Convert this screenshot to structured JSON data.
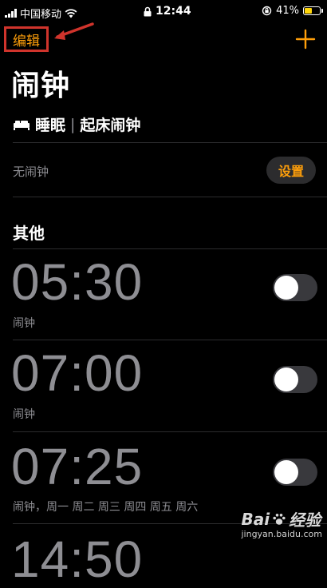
{
  "status_bar": {
    "carrier": "中国移动",
    "time": "12:44",
    "battery_percent": "41%"
  },
  "nav": {
    "edit_label": "编辑",
    "add_icon": "plus-icon"
  },
  "title": "闹钟",
  "sleep": {
    "icon": "bed-icon",
    "label": "睡眠",
    "separator": "|",
    "sublabel": "起床闹钟",
    "no_alarm_text": "无闹钟",
    "setup_label": "设置"
  },
  "other_section": {
    "title": "其他"
  },
  "alarms": [
    {
      "time": "05:30",
      "label": "闹钟",
      "enabled": false
    },
    {
      "time": "07:00",
      "label": "闹钟",
      "enabled": false
    },
    {
      "time": "07:25",
      "label": "闹钟，周一 周二 周三 周四 周五 周六",
      "enabled": false
    },
    {
      "time": "14:50",
      "label": "",
      "enabled": false
    }
  ],
  "watermark": {
    "brand": "Bai",
    "brand_suffix": "经验",
    "url": "jingyan.baidu.com"
  },
  "colors": {
    "accent": "#ff9f0a",
    "annotation": "#d0342c",
    "toggle_off": "#39393d",
    "secondary_text": "#8e8e93"
  }
}
